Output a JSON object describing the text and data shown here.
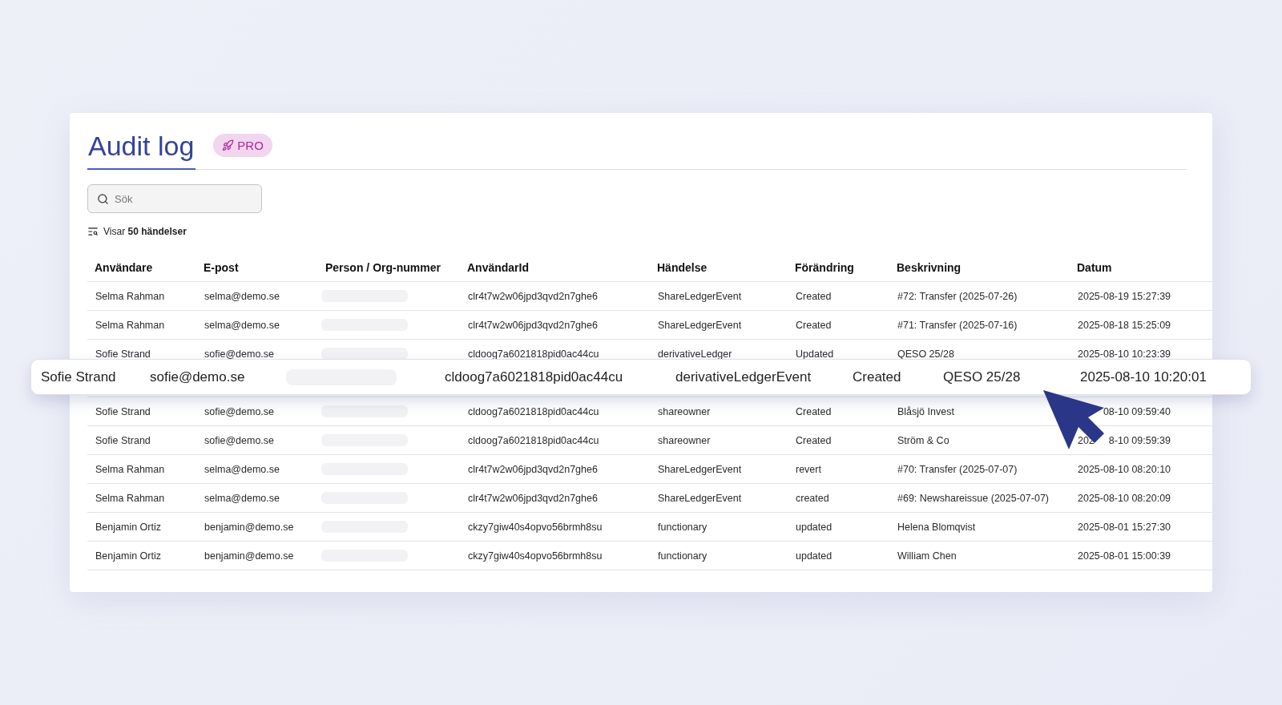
{
  "title": "Audit log",
  "badge": "PRO",
  "search": {
    "placeholder": "Sök"
  },
  "summary": "Visar **50 händelser**",
  "table": {
    "columns": [
      "Användare",
      "E-post",
      "Person / Org-nummer",
      "AnvändarId",
      "Händelse",
      "Förändring",
      "Beskrivning",
      "Datum"
    ],
    "rows": [
      {
        "user": "Selma Rahman",
        "email": "selma@demo.se",
        "user_id": "clr4t7w2w06jpd3qvd2n7ghe6",
        "event": "ShareLedgerEvent",
        "change": "Created",
        "description": "#72: Transfer (2025-07-26)",
        "date": "2025-08-19 15:27:39"
      },
      {
        "user": "Selma Rahman",
        "email": "selma@demo.se",
        "user_id": "clr4t7w2w06jpd3qvd2n7ghe6",
        "event": "ShareLedgerEvent",
        "change": "Created",
        "description": "#71: Transfer (2025-07-16)",
        "date": "2025-08-18 15:25:09"
      },
      {
        "user": "Sofie Strand",
        "email": "sofie@demo.se",
        "user_id": "cldoog7a6021818pid0ac44cu",
        "event": "derivativeLedger",
        "change": "Updated",
        "description": "QESO 25/28",
        "date": "2025-08-10 10:23:39"
      },
      {
        "user": "Sofie Strand",
        "email": "sofie@demo.se",
        "user_id": "cldoog7a6021818pid0ac44cu",
        "event": "shareowner",
        "change": "Created",
        "description": "Blåsjö Invest",
        "date": "08-10 09:59:40"
      },
      {
        "user": "Sofie Strand",
        "email": "sofie@demo.se",
        "user_id": "cldoog7a6021818pid0ac44cu",
        "event": "shareowner",
        "change": "Created",
        "description": "Ström & Co",
        "date_prefix": "202",
        "date": "8-10 09:59:39"
      },
      {
        "user": "Selma Rahman",
        "email": "selma@demo.se",
        "user_id": "clr4t7w2w06jpd3qvd2n7ghe6",
        "event": "ShareLedgerEvent",
        "change": "revert",
        "description": "#70: Transfer (2025-07-07)",
        "date": "2025-08-10 08:20:10"
      },
      {
        "user": "Selma Rahman",
        "email": "selma@demo.se",
        "user_id": "clr4t7w2w06jpd3qvd2n7ghe6",
        "event": "ShareLedgerEvent",
        "change": "created",
        "description": "#69: Newshareissue (2025-07-07)",
        "date": "2025-08-10 08:20:09"
      },
      {
        "user": "Benjamin Ortiz",
        "email": "benjamin@demo.se",
        "user_id": "ckzy7giw40s4opvo56brmh8su",
        "event": "functionary",
        "change": "updated",
        "description": "Helena Blomqvist",
        "date": "2025-08-01 15:27:30"
      },
      {
        "user": "Benjamin Ortiz",
        "email": "benjamin@demo.se",
        "user_id": "ckzy7giw40s4opvo56brmh8su",
        "event": "functionary",
        "change": "updated",
        "description": "William Chen",
        "date": "2025-08-01 15:00:39"
      }
    ]
  },
  "highlighted_row": {
    "user": "Sofie Strand",
    "email": "sofie@demo.se",
    "user_id": "cldoog7a6021818pid0ac44cu",
    "event": "derivativeLedgerEvent",
    "change": "Created",
    "description": "QESO 25/28",
    "date": "2025-08-10 10:20:01"
  }
}
